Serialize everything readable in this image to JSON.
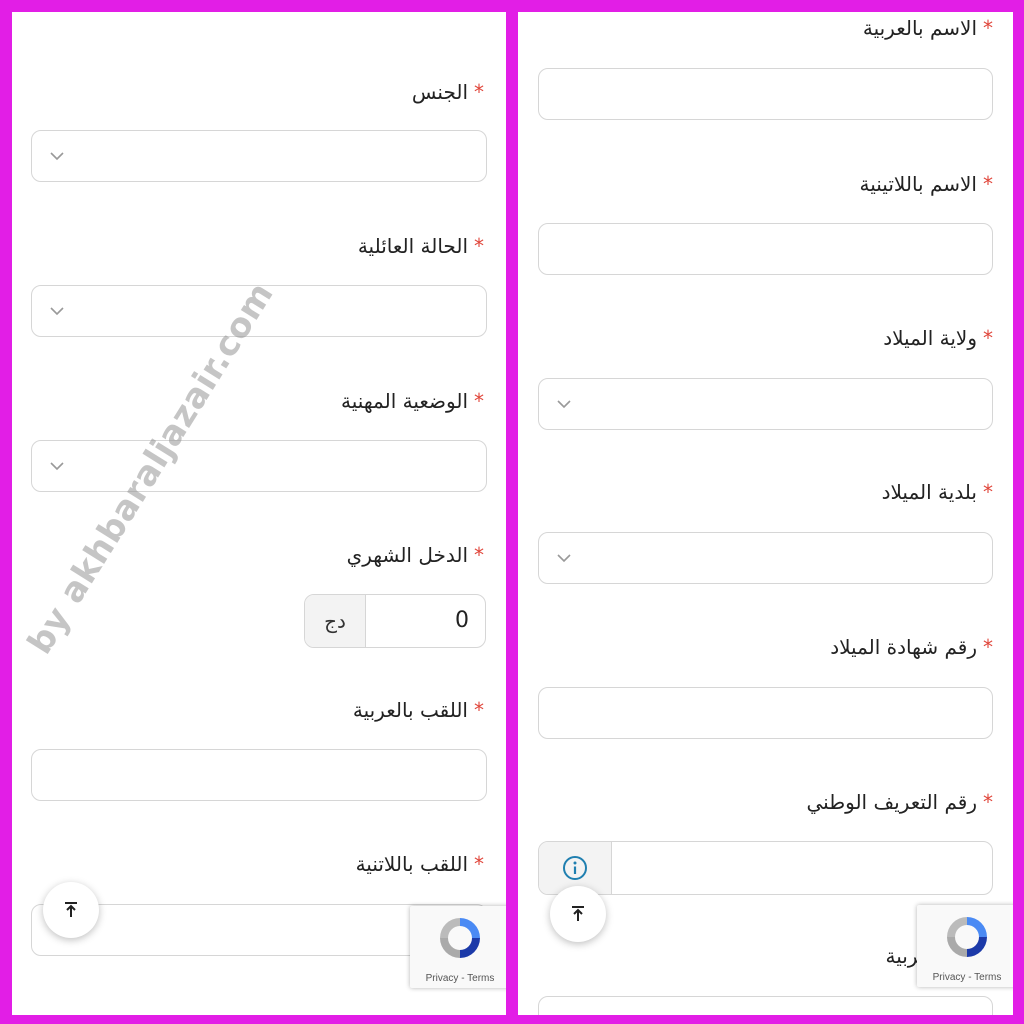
{
  "left_panel": {
    "fields": [
      {
        "label": "الجنس",
        "type": "select"
      },
      {
        "label": "الحالة العائلية",
        "type": "select"
      },
      {
        "label": "الوضعية المهنية",
        "type": "select"
      },
      {
        "label": "الدخل الشهري",
        "type": "currency",
        "value": "0",
        "currency": "دج"
      },
      {
        "label": "اللقب بالعربية",
        "type": "text"
      },
      {
        "label": "اللقب باللاتنية",
        "type": "text"
      }
    ]
  },
  "right_panel": {
    "fields": [
      {
        "label": "الاسم بالعربية",
        "type": "text"
      },
      {
        "label": "الاسم باللاتينية",
        "type": "text"
      },
      {
        "label": "ولاية الميلاد",
        "type": "select"
      },
      {
        "label": "بلدية الميلاد",
        "type": "select"
      },
      {
        "label": "رقم شهادة الميلاد",
        "type": "text"
      },
      {
        "label": "رقم التعريف الوطني",
        "type": "info-text"
      },
      {
        "label": "أب بالعربية",
        "type": "text"
      }
    ]
  },
  "required_marker": "*",
  "recaptcha": {
    "links": "Privacy - Terms"
  },
  "watermark": "by akhbaraljazair.com",
  "colors": {
    "frame": "#e21ee6",
    "required": "#e0453a",
    "info": "#1f7fb0"
  },
  "icons": [
    "chevron-down-icon",
    "scroll-to-top-icon",
    "info-icon",
    "recaptcha-logo-icon"
  ]
}
